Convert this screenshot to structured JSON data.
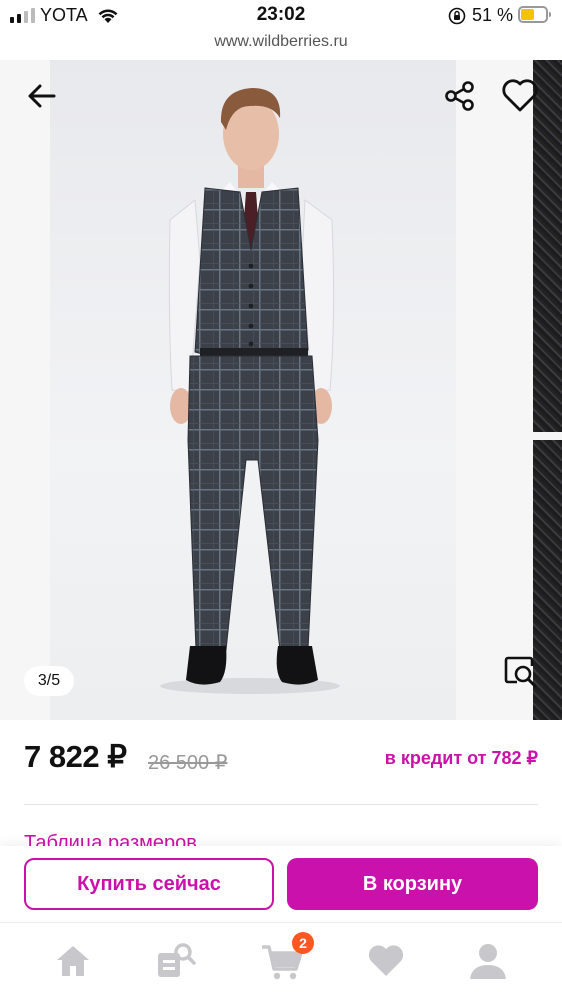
{
  "status_bar": {
    "carrier": "YOTA",
    "time": "23:02",
    "battery_percent": "51 %",
    "battery_level": 0.51
  },
  "browser": {
    "url": "www.wildberries.ru"
  },
  "gallery": {
    "counter": "3/5",
    "current_image": 3,
    "total_images": 5,
    "icons": {
      "back": "arrow-left-icon",
      "share": "share-icon",
      "favorite": "heart-icon",
      "zoom": "zoom-search-icon"
    }
  },
  "product": {
    "price": "7 822 ₽",
    "old_price": "26 500 ₽",
    "credit": "в кредит от 782 ₽",
    "size_table_link": "Таблица размеров"
  },
  "actions": {
    "buy_now": "Купить сейчас",
    "add_to_cart": "В корзину"
  },
  "tabbar": {
    "items": [
      {
        "name": "home",
        "icon": "home-icon"
      },
      {
        "name": "catalog",
        "icon": "catalog-search-icon"
      },
      {
        "name": "cart",
        "icon": "cart-icon",
        "badge": "2"
      },
      {
        "name": "favorites",
        "icon": "heart-icon"
      },
      {
        "name": "profile",
        "icon": "user-icon"
      }
    ]
  },
  "colors": {
    "accent": "#cb11ab",
    "badge": "#ff5722",
    "icon_inactive": "#c8c8cc",
    "battery_fill": "#f4c300"
  }
}
